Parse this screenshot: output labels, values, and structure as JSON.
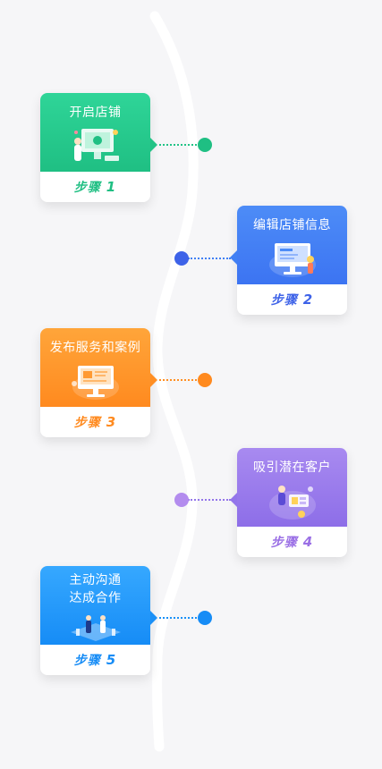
{
  "steps": [
    {
      "title": "开启店铺",
      "label": "步骤",
      "number": "1",
      "color": "#1fbf83"
    },
    {
      "title": "编辑店铺信息",
      "label": "步骤",
      "number": "2",
      "color": "#3d62e8"
    },
    {
      "title": "发布服务和案例",
      "label": "步骤",
      "number": "3",
      "color": "#ff8a1f"
    },
    {
      "title": "吸引潜在客户",
      "label": "步骤",
      "number": "4",
      "color": "#9a6fe5"
    },
    {
      "title_line1": "主动沟通",
      "title_line2": "达成合作",
      "label": "步骤",
      "number": "5",
      "color": "#168cf6"
    }
  ],
  "icons": [
    "shop-opening-illustration",
    "store-info-monitor-illustration",
    "service-publish-monitor-illustration",
    "customer-attraction-illustration",
    "cooperation-illustration"
  ]
}
